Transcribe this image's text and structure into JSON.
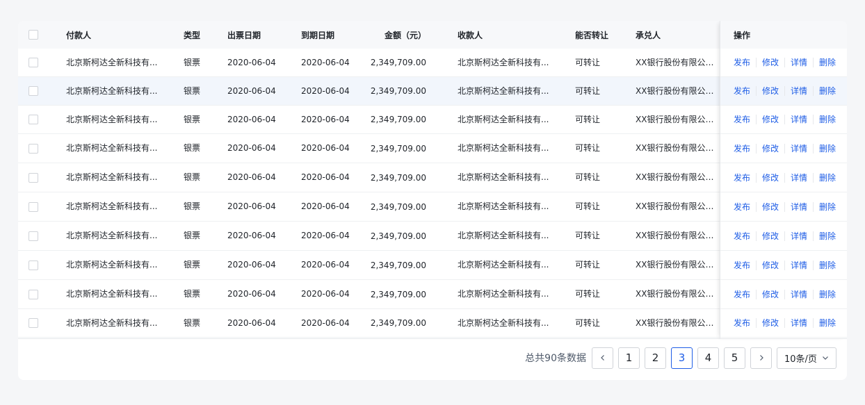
{
  "table": {
    "headers": {
      "payer": "付款人",
      "type": "类型",
      "issue_date": "出票日期",
      "due_date": "到期日期",
      "amount": "金额（元）",
      "payee": "收款人",
      "transferable": "能否转让",
      "acceptor": "承兑人",
      "ops": "操作"
    },
    "highlighted_row": 1,
    "rows": [
      {
        "payer": "北京斯柯达全新科技有...",
        "type": "银票",
        "issue_date": "2020-06-04",
        "due_date": "2020-06-04",
        "amount": "2,349,709.00",
        "payee": "北京斯柯达全新科技有...",
        "transferable": "可转让",
        "acceptor": "XX银行股份有限公司..."
      },
      {
        "payer": "北京斯柯达全新科技有...",
        "type": "银票",
        "issue_date": "2020-06-04",
        "due_date": "2020-06-04",
        "amount": "2,349,709.00",
        "payee": "北京斯柯达全新科技有...",
        "transferable": "可转让",
        "acceptor": "XX银行股份有限公司..."
      },
      {
        "payer": "北京斯柯达全新科技有...",
        "type": "银票",
        "issue_date": "2020-06-04",
        "due_date": "2020-06-04",
        "amount": "2,349,709.00",
        "payee": "北京斯柯达全新科技有...",
        "transferable": "可转让",
        "acceptor": "XX银行股份有限公司..."
      },
      {
        "payer": "北京斯柯达全新科技有...",
        "type": "银票",
        "issue_date": "2020-06-04",
        "due_date": "2020-06-04",
        "amount": "2,349,709.00",
        "payee": "北京斯柯达全新科技有...",
        "transferable": "可转让",
        "acceptor": "XX银行股份有限公司..."
      },
      {
        "payer": "北京斯柯达全新科技有...",
        "type": "银票",
        "issue_date": "2020-06-04",
        "due_date": "2020-06-04",
        "amount": "2,349,709.00",
        "payee": "北京斯柯达全新科技有...",
        "transferable": "可转让",
        "acceptor": "XX银行股份有限公司..."
      },
      {
        "payer": "北京斯柯达全新科技有...",
        "type": "银票",
        "issue_date": "2020-06-04",
        "due_date": "2020-06-04",
        "amount": "2,349,709.00",
        "payee": "北京斯柯达全新科技有...",
        "transferable": "可转让",
        "acceptor": "XX银行股份有限公司..."
      },
      {
        "payer": "北京斯柯达全新科技有...",
        "type": "银票",
        "issue_date": "2020-06-04",
        "due_date": "2020-06-04",
        "amount": "2,349,709.00",
        "payee": "北京斯柯达全新科技有...",
        "transferable": "可转让",
        "acceptor": "XX银行股份有限公司..."
      },
      {
        "payer": "北京斯柯达全新科技有...",
        "type": "银票",
        "issue_date": "2020-06-04",
        "due_date": "2020-06-04",
        "amount": "2,349,709.00",
        "payee": "北京斯柯达全新科技有...",
        "transferable": "可转让",
        "acceptor": "XX银行股份有限公司..."
      },
      {
        "payer": "北京斯柯达全新科技有...",
        "type": "银票",
        "issue_date": "2020-06-04",
        "due_date": "2020-06-04",
        "amount": "2,349,709.00",
        "payee": "北京斯柯达全新科技有...",
        "transferable": "可转让",
        "acceptor": "XX银行股份有限公司..."
      },
      {
        "payer": "北京斯柯达全新科技有...",
        "type": "银票",
        "issue_date": "2020-06-04",
        "due_date": "2020-06-04",
        "amount": "2,349,709.00",
        "payee": "北京斯柯达全新科技有...",
        "transferable": "可转让",
        "acceptor": "XX银行股份有限公司..."
      }
    ],
    "actions": [
      "发布",
      "修改",
      "详情",
      "删除"
    ]
  },
  "pagination": {
    "total_text": "总共90条数据",
    "pages": [
      "1",
      "2",
      "3",
      "4",
      "5"
    ],
    "current_page": "3",
    "page_size": "10条/页",
    "prev_icon": "chevron-left-icon",
    "next_icon": "chevron-right-icon"
  },
  "colors": {
    "accent": "#1e5de6",
    "highlight_row": "#f2f6fc",
    "header_bg": "#f7f8fa"
  }
}
